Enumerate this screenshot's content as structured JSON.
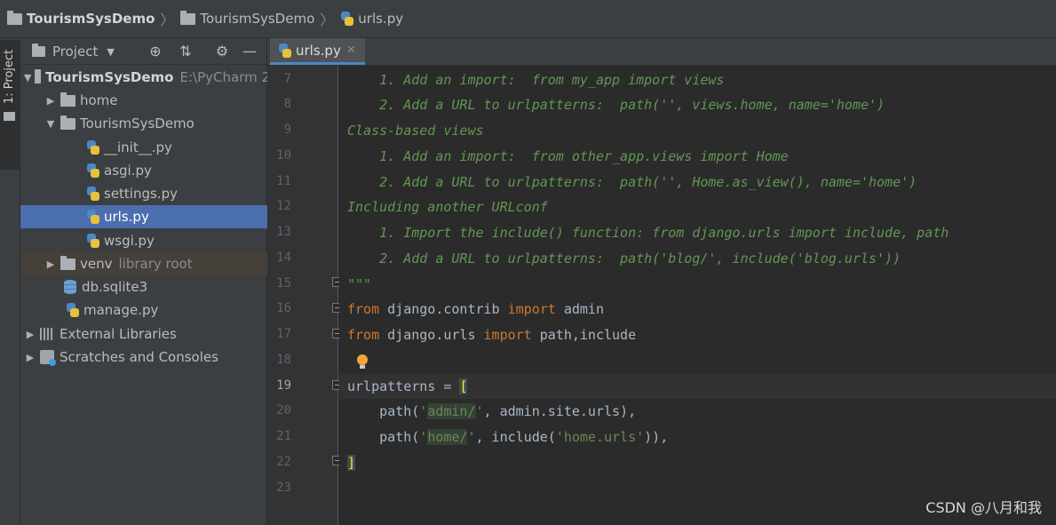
{
  "breadcrumb": {
    "project": "TourismSysDemo",
    "folder": "TourismSysDemo",
    "file": "urls.py"
  },
  "tool_stripe": {
    "project_label": "1: Project"
  },
  "project_panel": {
    "title": "Project",
    "tree": [
      {
        "label": "TourismSysDemo",
        "path": "E:\\PyCharm 2"
      },
      {
        "label": "home"
      },
      {
        "label": "TourismSysDemo"
      },
      {
        "label": "__init__.py"
      },
      {
        "label": "asgi.py"
      },
      {
        "label": "settings.py"
      },
      {
        "label": "urls.py"
      },
      {
        "label": "wsgi.py"
      },
      {
        "label": "venv",
        "hint": "library root"
      },
      {
        "label": "db.sqlite3"
      },
      {
        "label": "manage.py"
      },
      {
        "label": "External Libraries"
      },
      {
        "label": "Scratches and Consoles"
      }
    ]
  },
  "editor": {
    "tab": "urls.py",
    "line_numbers": [
      "7",
      "8",
      "9",
      "10",
      "11",
      "12",
      "13",
      "14",
      "15",
      "16",
      "17",
      "18",
      "19",
      "20",
      "21",
      "22",
      "23"
    ],
    "code": {
      "l7": "    1. Add an import:  from my_app import views",
      "l8": "    2. Add a URL to urlpatterns:  path('', views.home, name='home')",
      "l9": "Class-based views",
      "l10": "    1. Add an import:  from other_app.views import Home",
      "l11": "    2. Add a URL to urlpatterns:  path('', Home.as_view(), name='home')",
      "l12": "Including another URLconf",
      "l13": "    1. Import the include() function: from django.urls import include, path",
      "l14": "    2. Add a URL to urlpatterns:  path('blog/', include('blog.urls'))",
      "l15": "\"\"\"",
      "l16_kw1": "from",
      "l16_mod": " django.contrib ",
      "l16_kw2": "import",
      "l16_name": " admin",
      "l17_kw1": "from",
      "l17_mod": " django.urls ",
      "l17_kw2": "import",
      "l17_name": " path,include",
      "l19_a": "urlpatterns = ",
      "l19_b": "[",
      "l20_a": "    path(",
      "l20_b": "'",
      "l20_c": "admin/",
      "l20_d": "'",
      "l20_e": ", admin.site.urls),",
      "l21_a": "    path(",
      "l21_b": "'",
      "l21_c": "home/",
      "l21_d": "'",
      "l21_e": ", include(",
      "l21_f": "'home.urls'",
      "l21_g": ")),",
      "l22": "]"
    }
  },
  "watermark": "CSDN @八月和我"
}
